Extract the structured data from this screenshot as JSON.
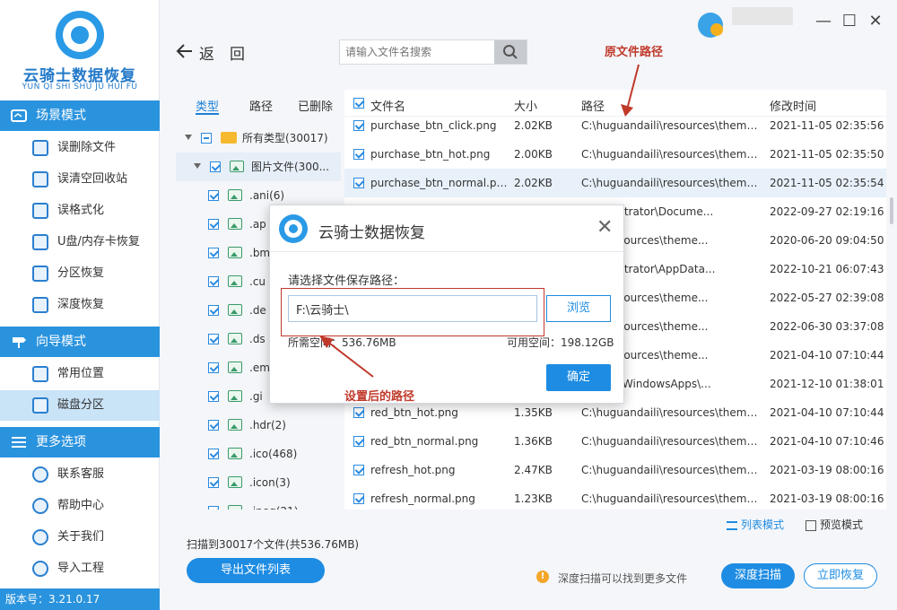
{
  "brand": {
    "name": "云骑士数据恢复",
    "pinyin": "YUN QI SHI SHU JU HUI FU"
  },
  "sidebar": {
    "sections": [
      {
        "label": "场景模式",
        "items": [
          "误删除文件",
          "误清空回收站",
          "误格式化",
          "U盘/内存卡恢复",
          "分区恢复",
          "深度恢复"
        ]
      },
      {
        "label": "向导模式",
        "items": [
          "常用位置",
          "磁盘分区"
        ]
      },
      {
        "label": "更多选项",
        "items": [
          "联系客服",
          "帮助中心",
          "关于我们",
          "导入工程"
        ]
      }
    ],
    "active_item": "磁盘分区",
    "version": "版本号：3.21.0.17"
  },
  "toolbar": {
    "back_label": "返　回",
    "search_placeholder": "请输入文件名搜索"
  },
  "filter": {
    "tabs": [
      "类型",
      "路径",
      "已删除"
    ],
    "active_tab": "类型",
    "tree": [
      {
        "label": "所有类型(30017)",
        "kind": "folder",
        "state": "partial",
        "level": 0
      },
      {
        "label": "图片文件(300...",
        "kind": "image",
        "state": "checked",
        "level": 1
      },
      {
        "label": ".ani(6)",
        "kind": "image",
        "state": "checked",
        "level": 2
      },
      {
        "label": ".ap",
        "kind": "image",
        "state": "checked",
        "level": 2
      },
      {
        "label": ".bm",
        "kind": "image",
        "state": "checked",
        "level": 2
      },
      {
        "label": ".cu",
        "kind": "image",
        "state": "checked",
        "level": 2
      },
      {
        "label": ".de",
        "kind": "image",
        "state": "checked",
        "level": 2
      },
      {
        "label": ".ds",
        "kind": "image",
        "state": "checked",
        "level": 2
      },
      {
        "label": ".em",
        "kind": "image",
        "state": "checked",
        "level": 2
      },
      {
        "label": ".gi",
        "kind": "image",
        "state": "checked",
        "level": 2
      },
      {
        "label": ".hdr(2)",
        "kind": "image",
        "state": "checked",
        "level": 2
      },
      {
        "label": ".ico(468)",
        "kind": "image",
        "state": "checked",
        "level": 2
      },
      {
        "label": ".icon(3)",
        "kind": "image",
        "state": "checked",
        "level": 2
      },
      {
        "label": ".jpeg(21)",
        "kind": "image",
        "state": "checked",
        "level": 2
      }
    ]
  },
  "table": {
    "columns": [
      "文件名",
      "大小",
      "路径",
      "修改时间"
    ],
    "rows": [
      {
        "name": "purchase_btn_click.png",
        "size": "2.02KB",
        "path": "C:\\huguandaili\\resources\\theme...",
        "time": "2021-11-05 02:35:56"
      },
      {
        "name": "purchase_btn_hot.png",
        "size": "2.00KB",
        "path": "C:\\huguandaili\\resources\\theme...",
        "time": "2021-11-05 02:35:50"
      },
      {
        "name": "purchase_btn_normal.png",
        "size": "2.02KB",
        "path": "C:\\huguandaili\\resources\\theme...",
        "time": "2021-11-05 02:35:54"
      },
      {
        "name": "",
        "size": "",
        "path": "Administrator\\Docume...",
        "time": "2022-09-27 02:19:16"
      },
      {
        "name": "",
        "size": "",
        "path": "daili\\resources\\theme...",
        "time": "2020-06-20 09:04:50"
      },
      {
        "name": "",
        "size": "",
        "path": "Administrator\\AppData...",
        "time": "2022-10-21 06:07:43"
      },
      {
        "name": "",
        "size": "",
        "path": "daili\\resources\\theme...",
        "time": "2022-05-27 02:39:08"
      },
      {
        "name": "",
        "size": "",
        "path": "daili\\resources\\theme...",
        "time": "2022-06-30 03:37:08"
      },
      {
        "name": "",
        "size": "",
        "path": "daili\\resources\\theme...",
        "time": "2021-04-10 07:10:44"
      },
      {
        "name": "",
        "size": "",
        "path": "m Files\\WindowsApps\\...",
        "time": "2021-12-10 01:38:01"
      },
      {
        "name": "red_btn_hot.png",
        "size": "1.35KB",
        "path": "C:\\huguandaili\\resources\\theme...",
        "time": "2021-04-10 07:10:44"
      },
      {
        "name": "red_btn_normal.png",
        "size": "1.36KB",
        "path": "C:\\huguandaili\\resources\\theme...",
        "time": "2021-04-10 07:10:46"
      },
      {
        "name": "refresh_hot.png",
        "size": "2.47KB",
        "path": "C:\\huguandaili\\resources\\theme...",
        "time": "2021-03-19 08:00:16"
      },
      {
        "name": "refresh_normal.png",
        "size": "1.23KB",
        "path": "C:\\huguandaili\\resources\\theme...",
        "time": "2021-03-19 08:00:16"
      }
    ]
  },
  "bottom": {
    "scan_info": "扫描到30017个文件(共536.76MB)",
    "export_label": "导出文件列表",
    "list_mode": "列表模式",
    "preview_mode": "预览模式",
    "tip": "深度扫描可以找到更多文件",
    "deep_scan": "深度扫描",
    "recover_now": "立即恢复"
  },
  "dialog": {
    "title": "云骑士数据恢复",
    "label": "请选择文件保存路径：",
    "path_value": "F:\\云骑士\\",
    "browse": "浏览",
    "required_space": "所需空间：536.76MB",
    "available_space": "可用空间：198.12GB",
    "ok": "确定"
  },
  "annotations": {
    "original_path": "原文件路径",
    "set_path": "设置后的路径"
  },
  "colors": {
    "accent": "#1e8ce3",
    "sidebar_header": "#2a93de",
    "annotation": "#c0392b"
  }
}
